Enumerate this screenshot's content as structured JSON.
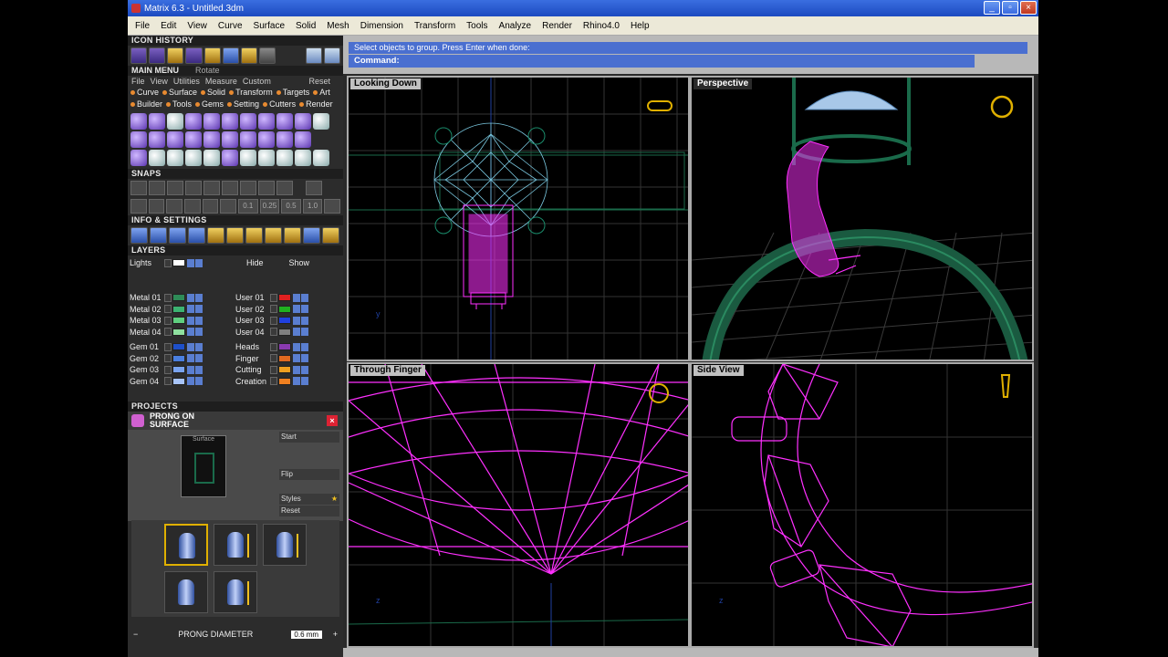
{
  "window": {
    "title": "Matrix 6.3 - Untitled.3dm"
  },
  "menubar": {
    "items": [
      "File",
      "Edit",
      "View",
      "Curve",
      "Surface",
      "Solid",
      "Mesh",
      "Dimension",
      "Transform",
      "Tools",
      "Analyze",
      "Render",
      "Rhino4.0",
      "Help"
    ]
  },
  "left": {
    "icon_history": "ICON HISTORY",
    "main_menu": {
      "title": "MAIN MENU",
      "current": "Rotate",
      "submenu": [
        "File",
        "View",
        "Utilities",
        "Measure",
        "Custom"
      ],
      "reset": "Reset",
      "categories_row1": [
        "Curve",
        "Surface",
        "Solid",
        "Transform",
        "Targets",
        "Art"
      ],
      "categories_row2": [
        "Builder",
        "Tools",
        "Gems",
        "Setting",
        "Cutters",
        "Render"
      ]
    },
    "snaps": "SNAPS",
    "snap_values": [
      "0.1",
      "0.25",
      "0.5",
      "1.0"
    ],
    "info_settings": "INFO & SETTINGS",
    "layers": {
      "title": "LAYERS",
      "lights": "Lights",
      "hide": "Hide",
      "show": "Show",
      "left": [
        {
          "name": "Metal 01",
          "color": "#2e8b57"
        },
        {
          "name": "Metal 02",
          "color": "#3cb371"
        },
        {
          "name": "Metal 03",
          "color": "#5fcf7f"
        },
        {
          "name": "Metal 04",
          "color": "#8fe09f"
        },
        {
          "name": "Gem 01",
          "color": "#1e4fc8"
        },
        {
          "name": "Gem 02",
          "color": "#4a7fe0"
        },
        {
          "name": "Gem 03",
          "color": "#7aa4f0"
        },
        {
          "name": "Gem 04",
          "color": "#a8c4f8"
        }
      ],
      "right": [
        {
          "name": "User 01",
          "color": "#e02020"
        },
        {
          "name": "User 02",
          "color": "#20b020"
        },
        {
          "name": "User 03",
          "color": "#2040e0"
        },
        {
          "name": "User 04",
          "color": "#808080"
        },
        {
          "name": "Heads",
          "color": "#8a3ab0"
        },
        {
          "name": "Finger",
          "color": "#e06a20"
        },
        {
          "name": "Cutting",
          "color": "#f0a020"
        },
        {
          "name": "Creation",
          "color": "#f08020"
        }
      ]
    },
    "projects": "PROJECTS",
    "prong": {
      "title": "PRONG ON SURFACE",
      "thumb_caption": "Surface",
      "options": [
        "Start",
        "Flip",
        "Styles",
        "Reset"
      ],
      "diameter_label": "PRONG DIAMETER",
      "diameter_value": "0.6 mm"
    }
  },
  "command": {
    "prompt": "Select objects to group. Press Enter when done:",
    "label": "Command:"
  },
  "viewports": [
    "Looking Down",
    "Perspective",
    "Through Finger",
    "Side View"
  ]
}
